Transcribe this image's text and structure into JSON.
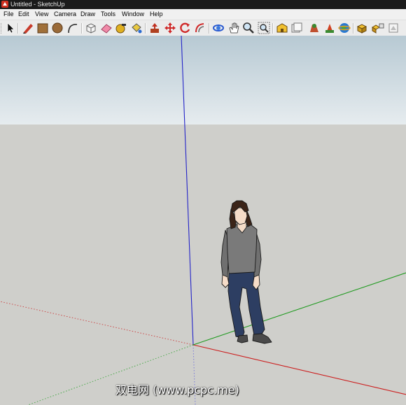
{
  "window": {
    "title": "Untitled - SketchUp"
  },
  "menu": [
    "File",
    "Edit",
    "View",
    "Camera",
    "Draw",
    "Tools",
    "Window",
    "Help"
  ],
  "toolbar": {
    "tools": [
      {
        "name": "select-tool",
        "icon": "arrow-cursor-icon"
      },
      {
        "name": "line-tool",
        "icon": "pencil-icon"
      },
      {
        "name": "rectangle-tool",
        "icon": "rectangle-icon"
      },
      {
        "name": "circle-tool",
        "icon": "circle-icon"
      },
      {
        "name": "arc-tool",
        "icon": "arc-icon"
      },
      {
        "name": "make-component-tool",
        "icon": "component-icon"
      },
      {
        "name": "eraser-tool",
        "icon": "eraser-icon"
      },
      {
        "name": "tape-measure-tool",
        "icon": "tape-measure-icon"
      },
      {
        "name": "paint-bucket-tool",
        "icon": "paint-bucket-icon"
      },
      {
        "name": "push-pull-tool",
        "icon": "push-pull-icon"
      },
      {
        "name": "move-tool",
        "icon": "move-icon"
      },
      {
        "name": "rotate-tool",
        "icon": "rotate-icon"
      },
      {
        "name": "offset-tool",
        "icon": "offset-icon"
      },
      {
        "name": "orbit-tool",
        "icon": "orbit-icon"
      },
      {
        "name": "pan-tool",
        "icon": "hand-icon"
      },
      {
        "name": "zoom-tool",
        "icon": "magnifier-icon"
      },
      {
        "name": "zoom-extents-tool",
        "icon": "zoom-extents-icon"
      },
      {
        "name": "get-models-tool",
        "icon": "warehouse-icon"
      },
      {
        "name": "share-model-tool",
        "icon": "share-icon"
      },
      {
        "name": "get-photo-texture-tool",
        "icon": "photo-texture-icon"
      },
      {
        "name": "add-location-tool",
        "icon": "location-icon"
      },
      {
        "name": "toggle-terrain-tool",
        "icon": "globe-icon"
      },
      {
        "name": "extension-warehouse-tool",
        "icon": "extension-icon"
      },
      {
        "name": "component-options-tool",
        "icon": "boxes-icon"
      },
      {
        "name": "send-to-layout-tool",
        "icon": "layout-icon"
      }
    ]
  },
  "scene": {
    "colors": {
      "sky": "#c9d7df",
      "ground": "#cfcfcb",
      "red_axis": "#d12020",
      "green_axis": "#22a022",
      "blue_axis": "#2020c0"
    },
    "figure": "person-figure"
  },
  "watermark": "双电网 (www.pcpc.me)"
}
